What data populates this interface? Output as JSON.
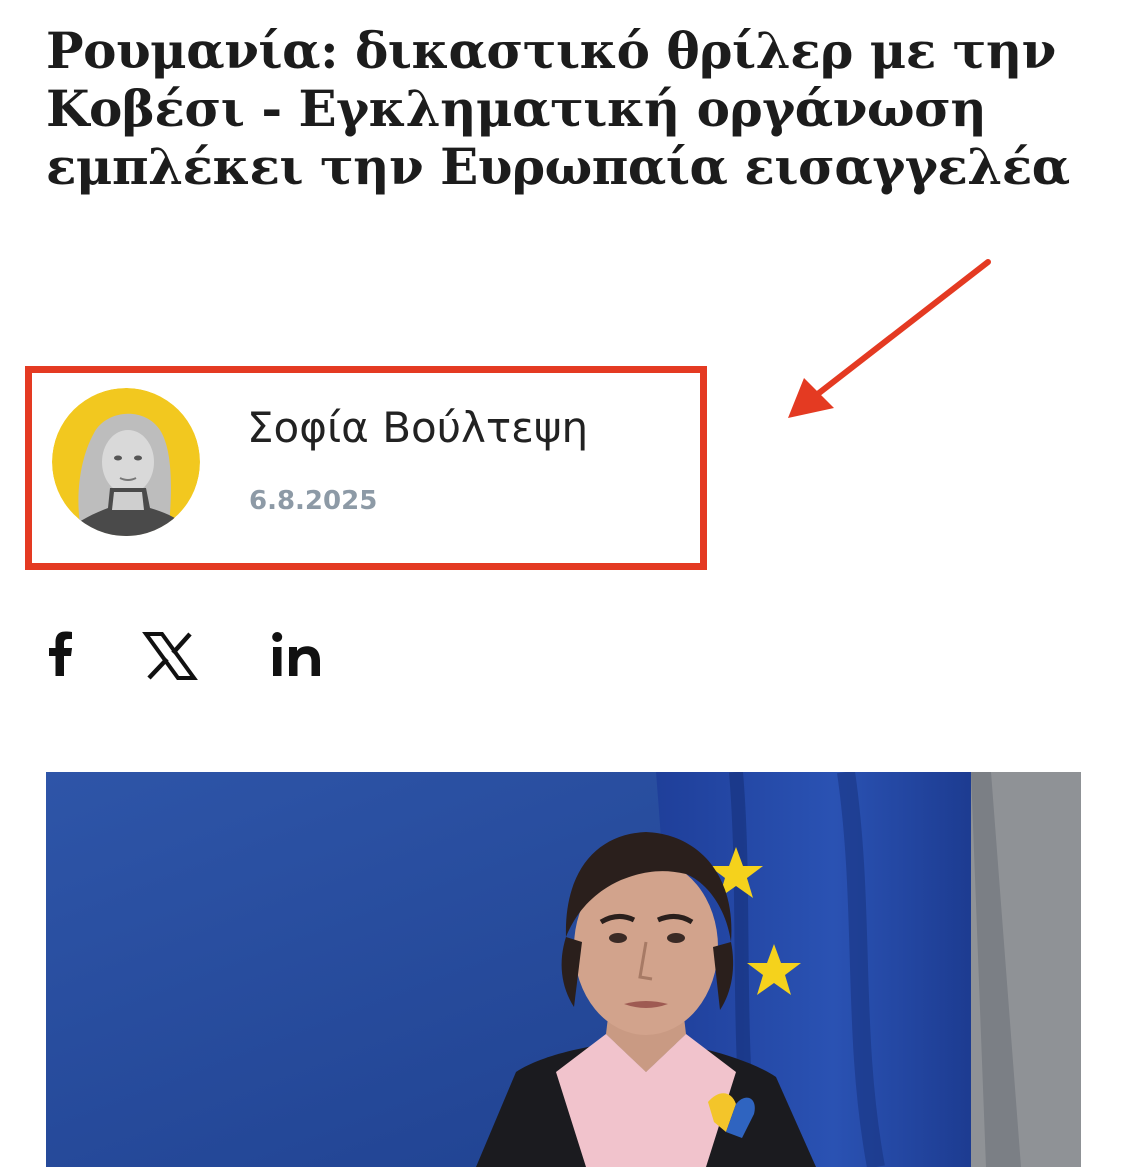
{
  "article": {
    "headline": "Ρουμανία: δικαστικό θρίλερ με την Κοβέσι - Εγκληματική οργάνωση εμπλέκει την Ευρωπαία εισαγγελέα"
  },
  "author": {
    "name": "Σοφία Βούλτεψη",
    "date": "6.8.2025"
  },
  "share": {
    "items": [
      {
        "network": "facebook",
        "icon": "facebook-icon"
      },
      {
        "network": "x",
        "icon": "x-icon"
      },
      {
        "network": "linkedin",
        "icon": "linkedin-icon"
      }
    ]
  },
  "colors": {
    "highlight_box": "#e43a22",
    "arrow": "#e43a22",
    "avatar_bg": "#f2c81f",
    "date_text": "#8d9aa6",
    "photo_bg": "#23469a"
  }
}
